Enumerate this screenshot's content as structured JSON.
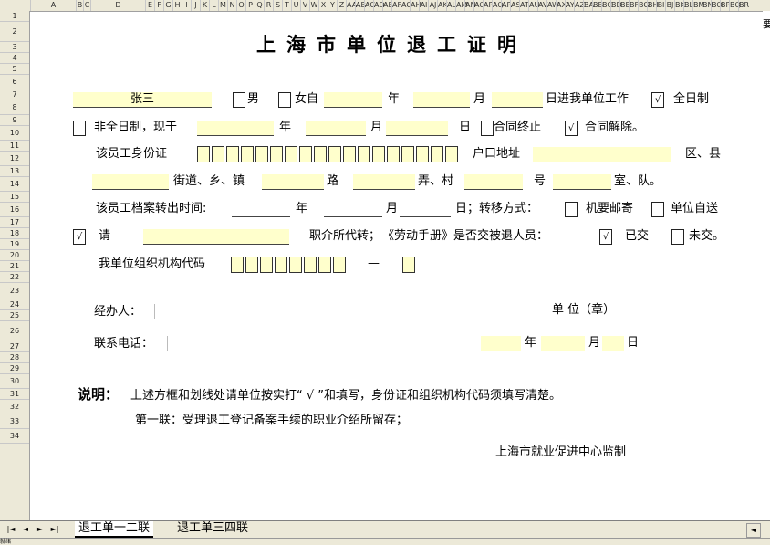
{
  "columns": [
    "A",
    "B",
    "C",
    "D",
    "E",
    "F",
    "G",
    "H",
    "I",
    "J",
    "K",
    "L",
    "M",
    "N",
    "O",
    "P",
    "Q",
    "R",
    "S",
    "T",
    "U",
    "V",
    "W",
    "X",
    "Y",
    "Z",
    "AA",
    "AB",
    "AC",
    "AD",
    "AE",
    "AF",
    "AG",
    "AH",
    "AI",
    "AJ",
    "AK",
    "AL",
    "AM",
    "AN",
    "AO",
    "AP",
    "AQ",
    "AR",
    "AS",
    "AT",
    "AU",
    "AV",
    "AW",
    "AX",
    "AY",
    "AZ",
    "BA",
    "BB",
    "BC",
    "BD",
    "BE",
    "BF",
    "BG",
    "BH",
    "BI",
    "BJ",
    "BK",
    "BL",
    "BM",
    "BN",
    "BO",
    "BP",
    "BQ",
    "BR"
  ],
  "rows": [
    "1",
    "2",
    "3",
    "4",
    "5",
    "6",
    "7",
    "8",
    "9",
    "10",
    "11",
    "12",
    "13",
    "14",
    "15",
    "16",
    "17",
    "18",
    "19",
    "20",
    "21",
    "22",
    "23",
    "24",
    "25",
    "26",
    "27",
    "28",
    "29",
    "30",
    "31",
    "32",
    "33",
    "34"
  ],
  "corner_text": "要",
  "form": {
    "title": "上海市单位退工证明",
    "name_value": "张三",
    "male": "男",
    "female_from": "女自",
    "year": "年",
    "month": "月",
    "day_join": "日进我单位工作",
    "check_mark": "√",
    "fulltime": "全日制",
    "nonfulltime": "非全日制，现于",
    "day": "日",
    "contract_end": "合同终止",
    "contract_cancel": "合同解除。",
    "id_label": "该员工身份证",
    "hukou_label": "户口地址",
    "district": "区、县",
    "street": "街道、乡、镇",
    "road": "路",
    "lane": "弄、村",
    "number": "号",
    "room": "室、队。",
    "archive_label": "该员工档案转出时间:",
    "transfer_day": "日；转移方式：",
    "mail": "机要邮寄",
    "self_deliver": "单位自送",
    "please": "请",
    "agency": "职介所代转；",
    "handbook": "《劳动手册》是否交被退人员：",
    "yes": "已交",
    "no": "未交。",
    "org_code_label": "我单位组织机构代码",
    "dash": "—",
    "handler": "经办人：",
    "unit_seal": "单 位（章）",
    "phone": "联系电话：",
    "note_title": "说明：",
    "note_text": "上述方框和划线处请单位按实打“ √ ”和填写，身份证和组织机构代码须填写清楚。",
    "copy_note": "第一联：受理退工登记备案手续的职业介绍所留存；",
    "supervisor": "上海市就业促进中心监制"
  },
  "tabs": [
    "退工单一二联",
    "退工单三四联"
  ],
  "status_text": "就绪"
}
